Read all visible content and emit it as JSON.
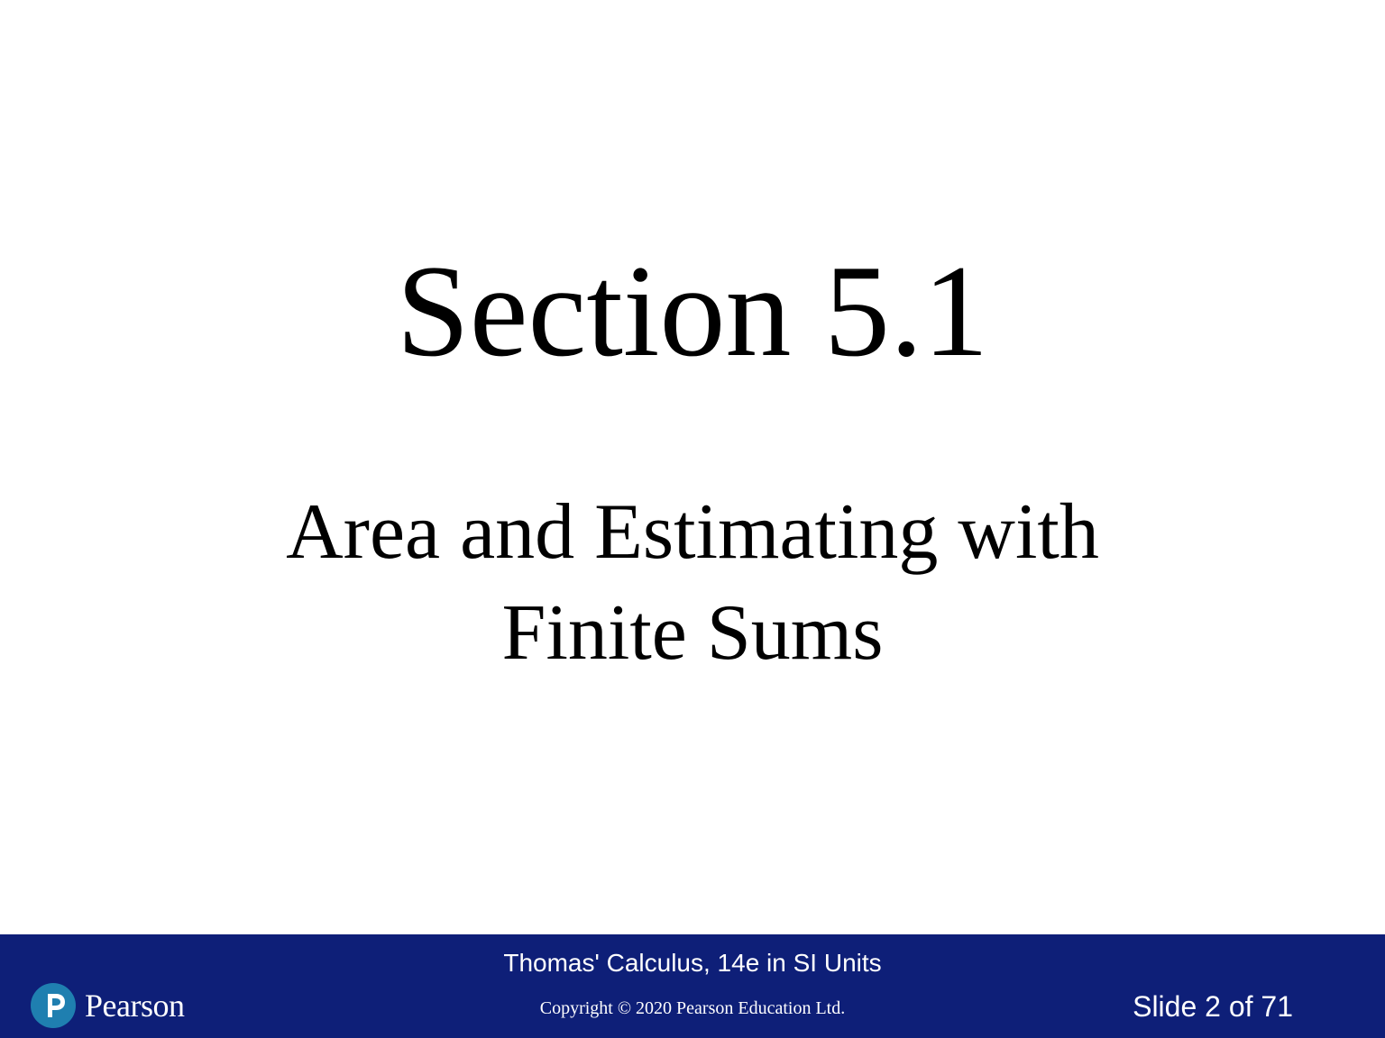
{
  "slide": {
    "section_title": "Section 5.1",
    "subtitle_lines": [
      "Area and Estimating with",
      "Finite Sums"
    ]
  },
  "footer": {
    "book_title": "Thomas' Calculus, 14e in SI Units",
    "copyright": "Copyright © 2020 Pearson Education Ltd.",
    "slide_number": "Slide 2 of 71",
    "logo_text": "Pearson",
    "background_color": "#0e1f78",
    "logo_color": "#1f7fb0",
    "logo_icon": "pearson-p-icon"
  }
}
